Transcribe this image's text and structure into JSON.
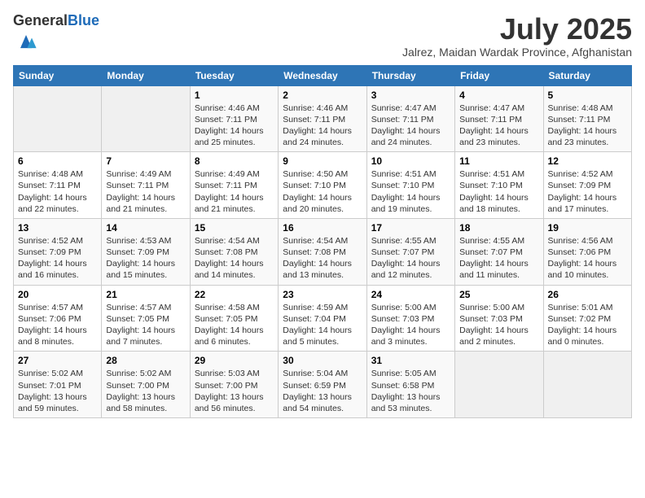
{
  "logo": {
    "general": "General",
    "blue": "Blue"
  },
  "header": {
    "month": "July 2025",
    "location": "Jalrez, Maidan Wardak Province, Afghanistan"
  },
  "weekdays": [
    "Sunday",
    "Monday",
    "Tuesday",
    "Wednesday",
    "Thursday",
    "Friday",
    "Saturday"
  ],
  "weeks": [
    [
      {
        "day": null
      },
      {
        "day": null
      },
      {
        "day": "1",
        "sunrise": "4:46 AM",
        "sunset": "7:11 PM",
        "daylight": "14 hours and 25 minutes."
      },
      {
        "day": "2",
        "sunrise": "4:46 AM",
        "sunset": "7:11 PM",
        "daylight": "14 hours and 24 minutes."
      },
      {
        "day": "3",
        "sunrise": "4:47 AM",
        "sunset": "7:11 PM",
        "daylight": "14 hours and 24 minutes."
      },
      {
        "day": "4",
        "sunrise": "4:47 AM",
        "sunset": "7:11 PM",
        "daylight": "14 hours and 23 minutes."
      },
      {
        "day": "5",
        "sunrise": "4:48 AM",
        "sunset": "7:11 PM",
        "daylight": "14 hours and 23 minutes."
      }
    ],
    [
      {
        "day": "6",
        "sunrise": "4:48 AM",
        "sunset": "7:11 PM",
        "daylight": "14 hours and 22 minutes."
      },
      {
        "day": "7",
        "sunrise": "4:49 AM",
        "sunset": "7:11 PM",
        "daylight": "14 hours and 21 minutes."
      },
      {
        "day": "8",
        "sunrise": "4:49 AM",
        "sunset": "7:11 PM",
        "daylight": "14 hours and 21 minutes."
      },
      {
        "day": "9",
        "sunrise": "4:50 AM",
        "sunset": "7:10 PM",
        "daylight": "14 hours and 20 minutes."
      },
      {
        "day": "10",
        "sunrise": "4:51 AM",
        "sunset": "7:10 PM",
        "daylight": "14 hours and 19 minutes."
      },
      {
        "day": "11",
        "sunrise": "4:51 AM",
        "sunset": "7:10 PM",
        "daylight": "14 hours and 18 minutes."
      },
      {
        "day": "12",
        "sunrise": "4:52 AM",
        "sunset": "7:09 PM",
        "daylight": "14 hours and 17 minutes."
      }
    ],
    [
      {
        "day": "13",
        "sunrise": "4:52 AM",
        "sunset": "7:09 PM",
        "daylight": "14 hours and 16 minutes."
      },
      {
        "day": "14",
        "sunrise": "4:53 AM",
        "sunset": "7:09 PM",
        "daylight": "14 hours and 15 minutes."
      },
      {
        "day": "15",
        "sunrise": "4:54 AM",
        "sunset": "7:08 PM",
        "daylight": "14 hours and 14 minutes."
      },
      {
        "day": "16",
        "sunrise": "4:54 AM",
        "sunset": "7:08 PM",
        "daylight": "14 hours and 13 minutes."
      },
      {
        "day": "17",
        "sunrise": "4:55 AM",
        "sunset": "7:07 PM",
        "daylight": "14 hours and 12 minutes."
      },
      {
        "day": "18",
        "sunrise": "4:55 AM",
        "sunset": "7:07 PM",
        "daylight": "14 hours and 11 minutes."
      },
      {
        "day": "19",
        "sunrise": "4:56 AM",
        "sunset": "7:06 PM",
        "daylight": "14 hours and 10 minutes."
      }
    ],
    [
      {
        "day": "20",
        "sunrise": "4:57 AM",
        "sunset": "7:06 PM",
        "daylight": "14 hours and 8 minutes."
      },
      {
        "day": "21",
        "sunrise": "4:57 AM",
        "sunset": "7:05 PM",
        "daylight": "14 hours and 7 minutes."
      },
      {
        "day": "22",
        "sunrise": "4:58 AM",
        "sunset": "7:05 PM",
        "daylight": "14 hours and 6 minutes."
      },
      {
        "day": "23",
        "sunrise": "4:59 AM",
        "sunset": "7:04 PM",
        "daylight": "14 hours and 5 minutes."
      },
      {
        "day": "24",
        "sunrise": "5:00 AM",
        "sunset": "7:03 PM",
        "daylight": "14 hours and 3 minutes."
      },
      {
        "day": "25",
        "sunrise": "5:00 AM",
        "sunset": "7:03 PM",
        "daylight": "14 hours and 2 minutes."
      },
      {
        "day": "26",
        "sunrise": "5:01 AM",
        "sunset": "7:02 PM",
        "daylight": "14 hours and 0 minutes."
      }
    ],
    [
      {
        "day": "27",
        "sunrise": "5:02 AM",
        "sunset": "7:01 PM",
        "daylight": "13 hours and 59 minutes."
      },
      {
        "day": "28",
        "sunrise": "5:02 AM",
        "sunset": "7:00 PM",
        "daylight": "13 hours and 58 minutes."
      },
      {
        "day": "29",
        "sunrise": "5:03 AM",
        "sunset": "7:00 PM",
        "daylight": "13 hours and 56 minutes."
      },
      {
        "day": "30",
        "sunrise": "5:04 AM",
        "sunset": "6:59 PM",
        "daylight": "13 hours and 54 minutes."
      },
      {
        "day": "31",
        "sunrise": "5:05 AM",
        "sunset": "6:58 PM",
        "daylight": "13 hours and 53 minutes."
      },
      {
        "day": null
      },
      {
        "day": null
      }
    ]
  ]
}
